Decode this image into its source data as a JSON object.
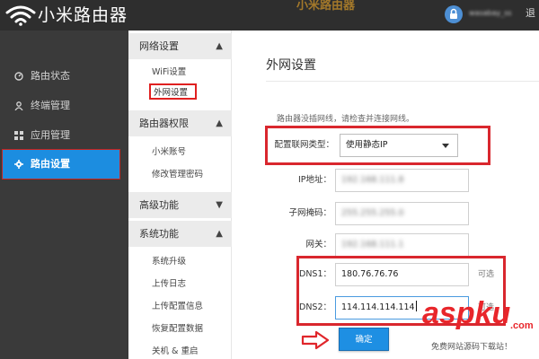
{
  "header": {
    "brand": "小米路由器",
    "center_text": "小米路由器",
    "username": "wasabay_ss",
    "logout_label": "退"
  },
  "sidebar": {
    "items": [
      {
        "label": "路由状态",
        "icon": "dashboard-icon"
      },
      {
        "label": "终端管理",
        "icon": "user-icon"
      },
      {
        "label": "应用管理",
        "icon": "grid-icon"
      },
      {
        "label": "路由设置",
        "icon": "gear-icon",
        "active": true
      }
    ]
  },
  "submenu": {
    "sections": [
      {
        "title": "网络设置",
        "items": [
          "WiFi设置",
          "外网设置"
        ]
      },
      {
        "title": "路由器权限",
        "items": [
          "小米账号",
          "修改管理密码"
        ]
      },
      {
        "title": "高级功能",
        "items": []
      },
      {
        "title": "系统功能",
        "items": [
          "系统升级",
          "上传日志",
          "上传配置信息",
          "恢复配置数据",
          "关机 & 重启"
        ]
      }
    ],
    "selected": "外网设置"
  },
  "main": {
    "title": "外网设置",
    "hint": "路由器没插网线，请检查并连接网线。",
    "connection_type": {
      "label": "配置联网类型：",
      "value": "使用静态IP"
    },
    "ip": {
      "label": "IP地址：",
      "value": "192.168.111.8"
    },
    "mask": {
      "label": "子网掩码：",
      "value": "255.255.255.0"
    },
    "gateway": {
      "label": "网关：",
      "value": "192.168.111.1"
    },
    "dns1": {
      "label": "DNS1：",
      "value": "180.76.76.76",
      "suffix": "可选"
    },
    "dns2": {
      "label": "DNS2：",
      "value": "114.114.114.114",
      "suffix": "可选"
    },
    "confirm_label": "确定"
  },
  "watermark": {
    "logo_text": "aspku",
    "logo_suffix": ".com",
    "caption": "免费网站源码下载站！"
  },
  "colors": {
    "header_bg": "#2e2e2e",
    "sidebar_bg": "#3a3a3a",
    "active_blue": "#1c8de0",
    "highlight_red": "#d9272e",
    "watermark_red": "#e8262b"
  }
}
